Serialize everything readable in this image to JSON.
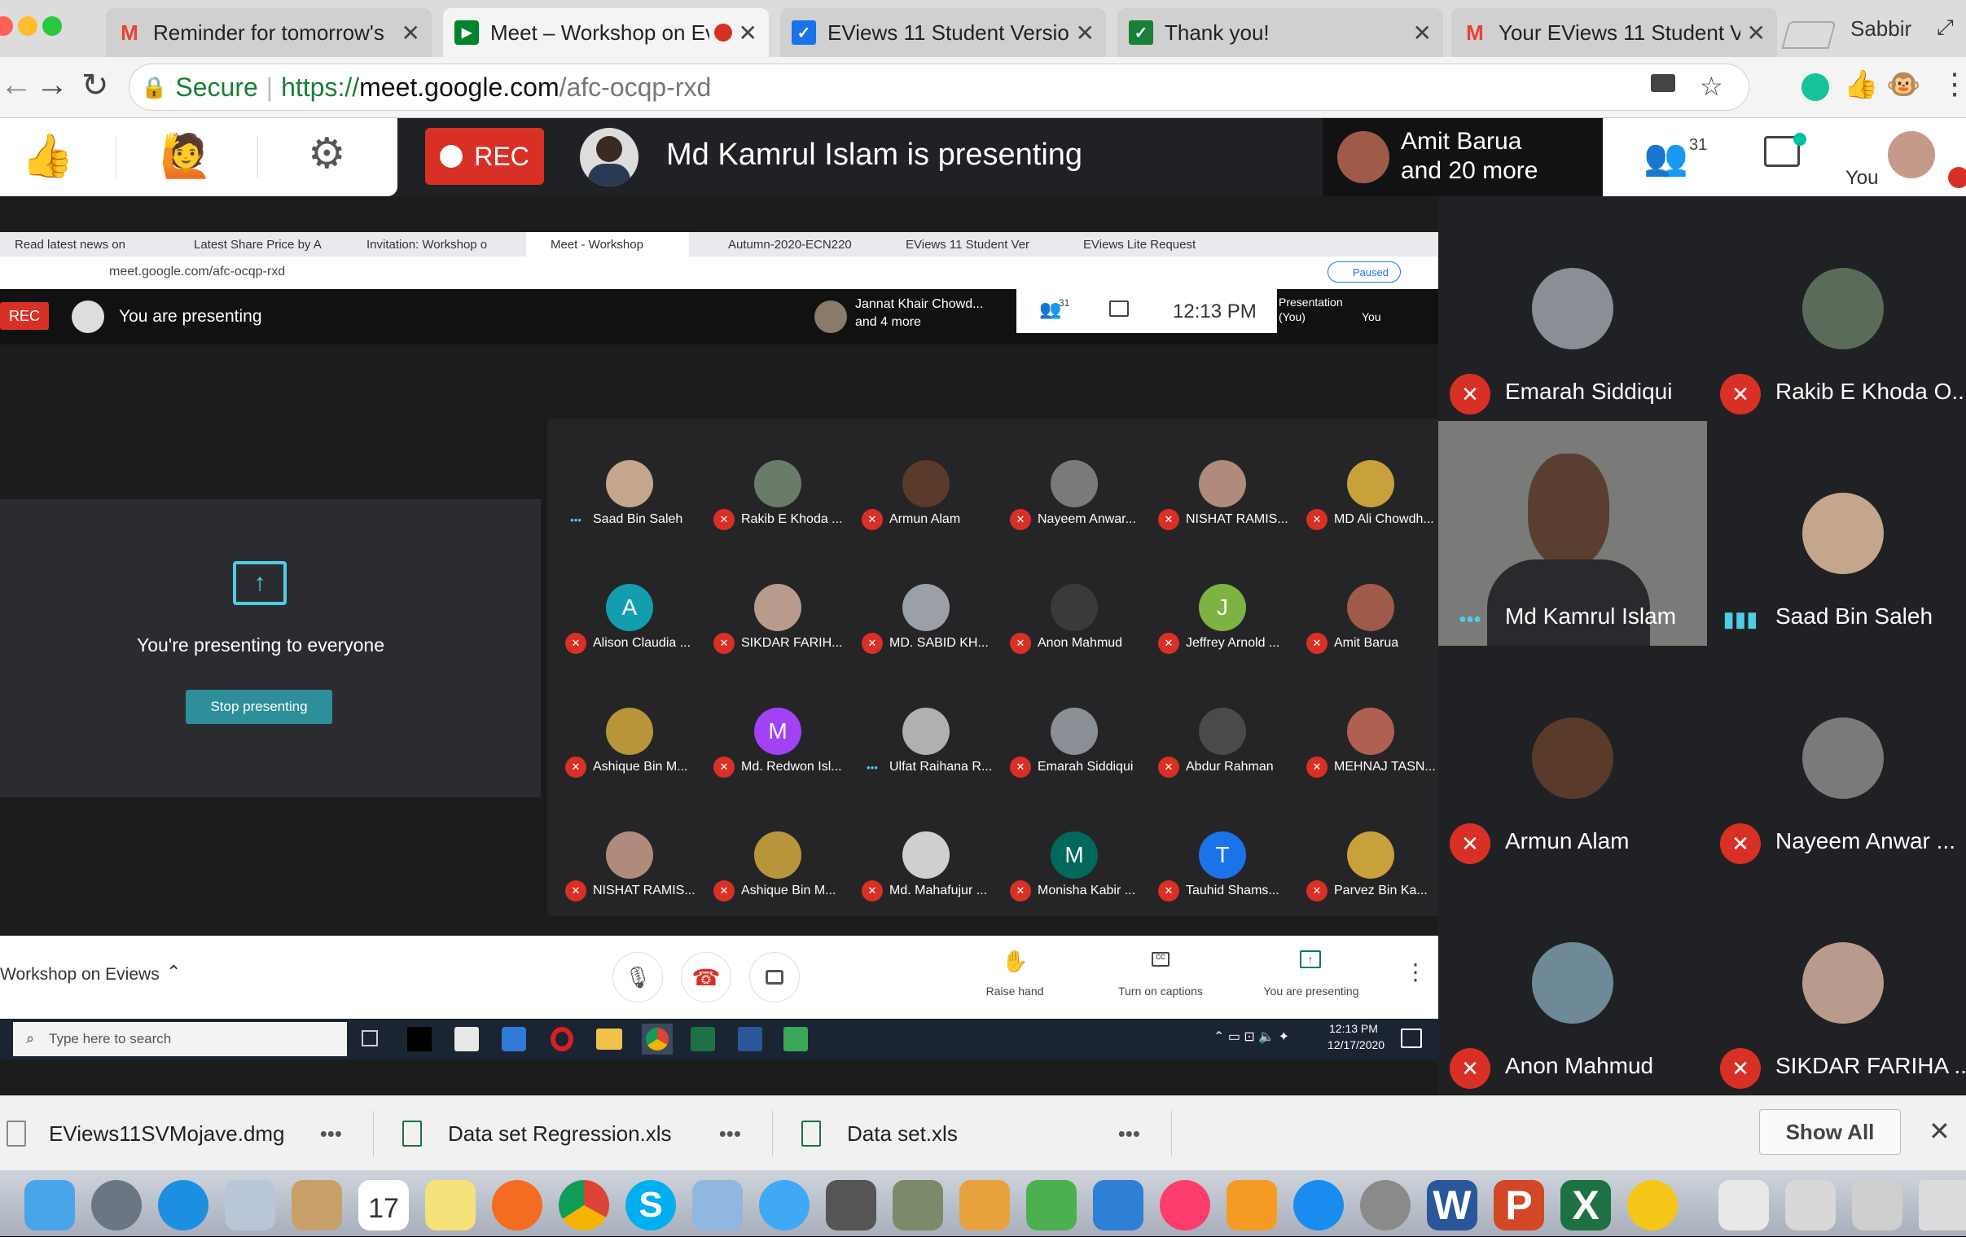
{
  "browser": {
    "user": "Sabbir",
    "tabs": [
      {
        "title": "Reminder for tomorrow's",
        "fav": "M",
        "color": "#ea4335"
      },
      {
        "title": "Meet – Workshop on Ev",
        "fav": "▶",
        "color": "#00832d",
        "active": true
      },
      {
        "title": "EViews 11 Student Versior",
        "fav": "✓",
        "color": "#1a73e8"
      },
      {
        "title": "Thank you!",
        "fav": "✓",
        "color": "#188038"
      },
      {
        "title": "Your EViews 11 Student V",
        "fav": "M",
        "color": "#ea4335"
      }
    ],
    "secure_label": "Secure",
    "url_scheme": "https://",
    "url_host": "meet.google.com",
    "url_path": "/afc-ocqp-rxd"
  },
  "meet": {
    "rec_label": "REC",
    "presenting_text": "Md Kamrul Islam is presenting",
    "others_line1": "Amit Barua",
    "others_line2": "and 20 more",
    "people_count": "31",
    "you_label": "You",
    "right_tiles": [
      {
        "name": "Emarah Siddiqui",
        "color": "#8a8f96"
      },
      {
        "name": "Rakib E Khoda O...",
        "color": "#5b6b5a"
      },
      {
        "name": "Md Kamrul Islam",
        "color": "#6d6d6d",
        "video": true
      },
      {
        "name": "Saad Bin Saleh",
        "color": "#c4a68c"
      },
      {
        "name": "Armun Alam",
        "color": "#5a3a2a"
      },
      {
        "name": "Nayeem Anwar ...",
        "color": "#7a7a7a"
      },
      {
        "name": "Anon Mahmud",
        "color": "#6e8a98"
      },
      {
        "name": "SIKDAR FARIHA ...",
        "color": "#b99b8d"
      }
    ]
  },
  "shared": {
    "tabs": [
      "Read latest news on",
      "Latest Share Price by A",
      "Invitation: Workshop o",
      "Meet - Workshop",
      "Autumn-2020-ECN220",
      "EViews 11 Student Ver",
      "EViews Lite Request"
    ],
    "url": "meet.google.com/afc-ocqp-rxd",
    "paused": "Paused",
    "rec": "REC",
    "you_presenting": "You are presenting",
    "others_line1": "Jannat Khair Chowd...",
    "others_line2": "and 4 more",
    "count": "31",
    "time": "12:13 PM",
    "presentation": "Presentation",
    "presentation_sub": "(You)",
    "you": "You",
    "presenting_everyone": "You're presenting to everyone",
    "stop_presenting": "Stop presenting",
    "meeting_name": "Workshop on Eviews",
    "raise_hand": "Raise hand",
    "captions": "Turn on captions",
    "you_are_presenting": "You are presenting",
    "search_placeholder": "Type here to search",
    "clock_time": "12:13 PM",
    "clock_date": "12/17/2020",
    "grid": [
      {
        "name": "Saad Bin Saleh",
        "color": "#c4a68c",
        "speaking": true
      },
      {
        "name": "Rakib E Khoda ...",
        "color": "#6b7b6a"
      },
      {
        "name": "Armun Alam",
        "color": "#5a3a2a"
      },
      {
        "name": "Nayeem Anwar...",
        "color": "#7a7a7a"
      },
      {
        "name": "NISHAT RAMIS...",
        "color": "#b08a7a"
      },
      {
        "name": "MD Ali Chowdh...",
        "color": "#c9a13a"
      },
      {
        "name": "Alison Claudia ...",
        "letter": "A",
        "color": "#129eaf"
      },
      {
        "name": "SIKDAR FARIH...",
        "color": "#b99b8d"
      },
      {
        "name": "MD. SABID KH...",
        "color": "#9aa0a6"
      },
      {
        "name": "Anon Mahmud",
        "color": "#3a3a3a"
      },
      {
        "name": "Jeffrey Arnold ...",
        "letter": "J",
        "color": "#7cb342"
      },
      {
        "name": "Amit Barua",
        "color": "#a05a4a"
      },
      {
        "name": "Ashique Bin M...",
        "color": "#b8953a"
      },
      {
        "name": "Md. Redwon Isl...",
        "letter": "M",
        "color": "#a142f4"
      },
      {
        "name": "Ulfat Raihana R...",
        "color": "#b0b0b0",
        "speaking": true
      },
      {
        "name": "Emarah Siddiqui",
        "color": "#8a8f96"
      },
      {
        "name": "Abdur Rahman",
        "color": "#4a4a4a"
      },
      {
        "name": "MEHNAJ TASN...",
        "color": "#b06050"
      },
      {
        "name": "NISHAT RAMIS...",
        "color": "#b08a7a"
      },
      {
        "name": "Ashique Bin M...",
        "color": "#b8953a"
      },
      {
        "name": "Md. Mahafujur ...",
        "color": "#cfcfcf"
      },
      {
        "name": "Monisha Kabir ...",
        "letter": "M",
        "color": "#00695c"
      },
      {
        "name": "Tauhid Shams...",
        "letter": "T",
        "color": "#1a73e8"
      },
      {
        "name": "Parvez Bin Ka...",
        "color": "#c9a13a"
      }
    ]
  },
  "downloads": {
    "items": [
      "EViews11SVMojave.dmg",
      "Data set Regression.xls",
      "Data set.xls"
    ],
    "show_all": "Show All"
  }
}
